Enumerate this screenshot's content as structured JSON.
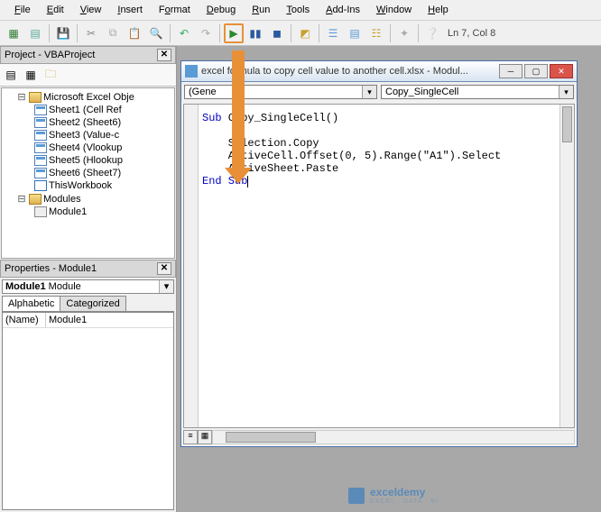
{
  "menu": {
    "items": [
      "File",
      "Edit",
      "View",
      "Insert",
      "Format",
      "Debug",
      "Run",
      "Tools",
      "Add-Ins",
      "Window",
      "Help"
    ]
  },
  "toolbar": {
    "status": "Ln 7, Col 8"
  },
  "project_pane": {
    "title": "Project - VBAProject",
    "root": "Microsoft Excel Obje",
    "sheets": [
      "Sheet1 (Cell Ref",
      "Sheet2 (Sheet6)",
      "Sheet3 (Value-c",
      "Sheet4 (Vlookup",
      "Sheet5 (Hlookup",
      "Sheet6 (Sheet7)"
    ],
    "workbook": "ThisWorkbook",
    "modules_folder": "Modules",
    "modules": [
      "Module1"
    ]
  },
  "properties_pane": {
    "title": "Properties - Module1",
    "selected_bold": "Module1",
    "selected_rest": " Module",
    "tabs": {
      "alphabetic": "Alphabetic",
      "categorized": "Categorized"
    },
    "row": {
      "key": "(Name)",
      "val": "Module1"
    }
  },
  "code_window": {
    "title": "excel formula to copy cell value to another cell.xlsx - Modul...",
    "combo_left": "(Gene",
    "combo_right": "Copy_SingleCell",
    "code": {
      "l1a": "Sub",
      "l1b": " Copy_SingleCell()",
      "l2": "",
      "l3": "    Selection.Copy",
      "l4": "    ActiveCell.Offset(0, 5).Range(\"A1\").Select",
      "l5": "    ActiveSheet.Paste",
      "l6a": "End Sub"
    }
  },
  "watermark": {
    "name": "exceldemy",
    "tag": "EXCEL · DATA · BI"
  }
}
